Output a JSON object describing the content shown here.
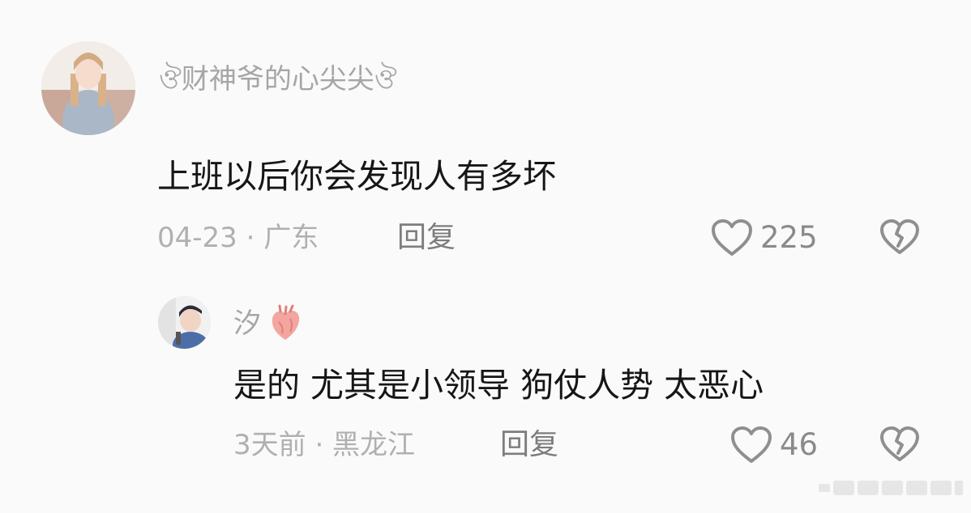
{
  "comments": [
    {
      "username": "ঔ财神爷的心尖尖ঔ",
      "text": "上班以后你会发现人有多坏",
      "meta": "04-23 · 广东",
      "reply_label": "回复",
      "likes": "225"
    },
    {
      "username": "汐",
      "text": "是的 尤其是小领导 狗仗人势 太恶心",
      "meta": "3天前 · 黑龙江",
      "reply_label": "回复",
      "likes": "46"
    }
  ],
  "icons": {
    "like": "heart-outline-icon",
    "dislike": "broken-heart-icon",
    "name_decoration": "anatomical-heart-icon"
  },
  "colors": {
    "username": "#a6a6a6",
    "text": "#161616",
    "meta": "#b0b0b0",
    "reply": "#7d7d7d",
    "count": "#8a8a8a",
    "heart_decoration": "#f3a5a0"
  }
}
